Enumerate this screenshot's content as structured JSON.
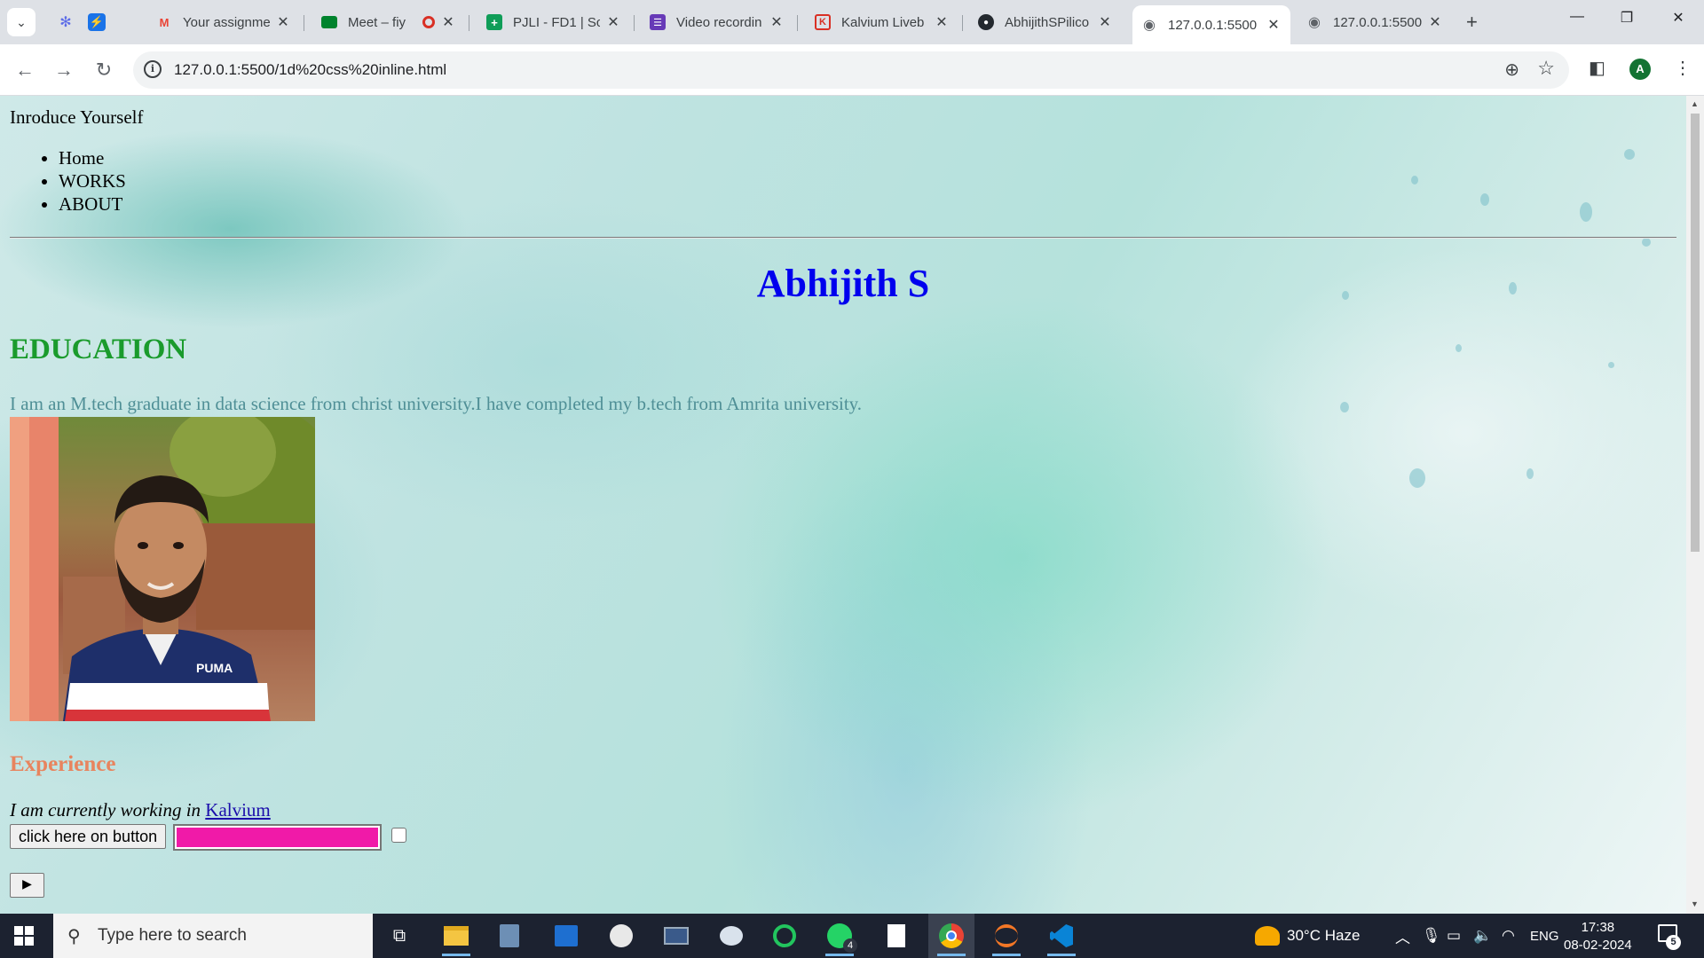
{
  "browser": {
    "tabs": [
      {
        "title": "Your assignme",
        "icon": "gmail-icon"
      },
      {
        "title": "Meet – fiy",
        "icon": "meet-icon",
        "recording": true
      },
      {
        "title": "PJLI - FD1 | Sc",
        "icon": "sheets-icon"
      },
      {
        "title": "Video recordin",
        "icon": "video-form-icon"
      },
      {
        "title": "Kalvium Liveb",
        "icon": "kalvium-icon"
      },
      {
        "title": "AbhijithSPilico",
        "icon": "github-icon"
      },
      {
        "title": "127.0.0.1:5500",
        "icon": "globe-icon",
        "active": true
      },
      {
        "title": "127.0.0.1:5500",
        "icon": "globe-icon"
      }
    ],
    "url": "127.0.0.1:5500/1d%20css%20inline.html",
    "profile_initial": "A"
  },
  "page": {
    "brand": "Inroduce Yourself",
    "nav": [
      "Home",
      "WORKS",
      "ABOUT"
    ],
    "name": "Abhijith S",
    "education_heading": "EDUCATION",
    "education_text": "I am an M.tech graduate in data science from christ university.I have completed my b.tech from Amrita university.",
    "photo_logo": "PUMA",
    "experience_heading": "Experience",
    "work_prefix": "I am currently working in ",
    "work_link": "Kalvium",
    "button_label": "click here on button",
    "color_value": "#f01aa8",
    "play_symbol": "▶"
  },
  "taskbar": {
    "search_placeholder": "Type here to search",
    "weather": "30°C  Haze",
    "language": "ENG",
    "time": "17:38",
    "date": "08-02-2024",
    "whatsapp_badge": "4",
    "notification_count": "5"
  }
}
